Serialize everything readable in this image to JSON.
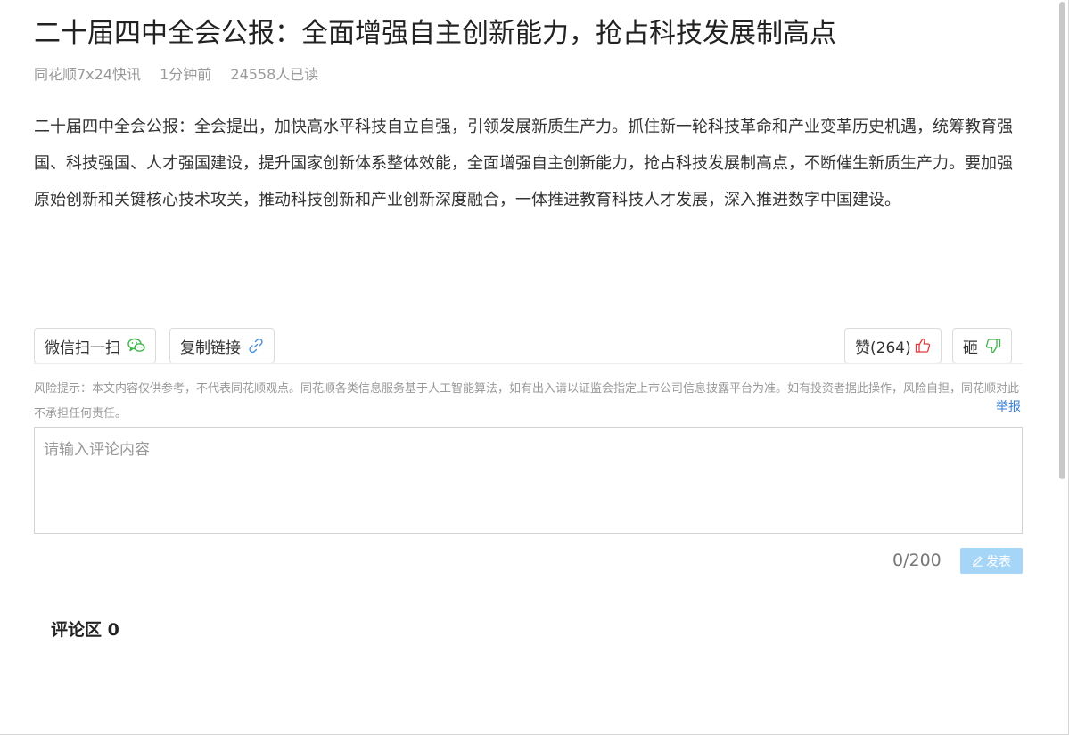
{
  "article": {
    "title": "二十届四中全会公报：全面增强自主创新能力，抢占科技发展制高点",
    "source": "同花顺7x24快讯",
    "time": "1分钟前",
    "reads": "24558人已读",
    "body": "二十届四中全会公报：全会提出，加快高水平科技自立自强，引领发展新质生产力。抓住新一轮科技革命和产业变革历史机遇，统筹教育强国、科技强国、人才强国建设，提升国家创新体系整体效能，全面增强自主创新能力，抢占科技发展制高点，不断催生新质生产力。要加强原始创新和关键核心技术攻关，推动科技创新和产业创新深度融合，一体推进教育科技人才发展，深入推进数字中国建设。"
  },
  "actions": {
    "wechat_label": "微信扫一扫",
    "copy_label": "复制链接",
    "like_label": "赞(264)",
    "dislike_label": "砸"
  },
  "risk_notice": "风险提示：本文内容仅供参考，不代表同花顺观点。同花顺各类信息服务基于人工智能算法，如有出入请以证监会指定上市公司信息披露平台为准。如有投资者据此操作，风险自担，同花顺对此不承担任何责任。",
  "report_label": "举报",
  "comment": {
    "placeholder": "请输入评论内容",
    "counter": "0/200",
    "publish_label": "发表",
    "section_title": "评论区 0"
  },
  "colors": {
    "wechat_icon": "#3bb54a",
    "link_icon": "#4a90d9",
    "like_icon": "#e4393c",
    "dislike_icon": "#3bb54a",
    "publish_bg": "#a5d5f7",
    "report_link": "#3a7fd5"
  }
}
